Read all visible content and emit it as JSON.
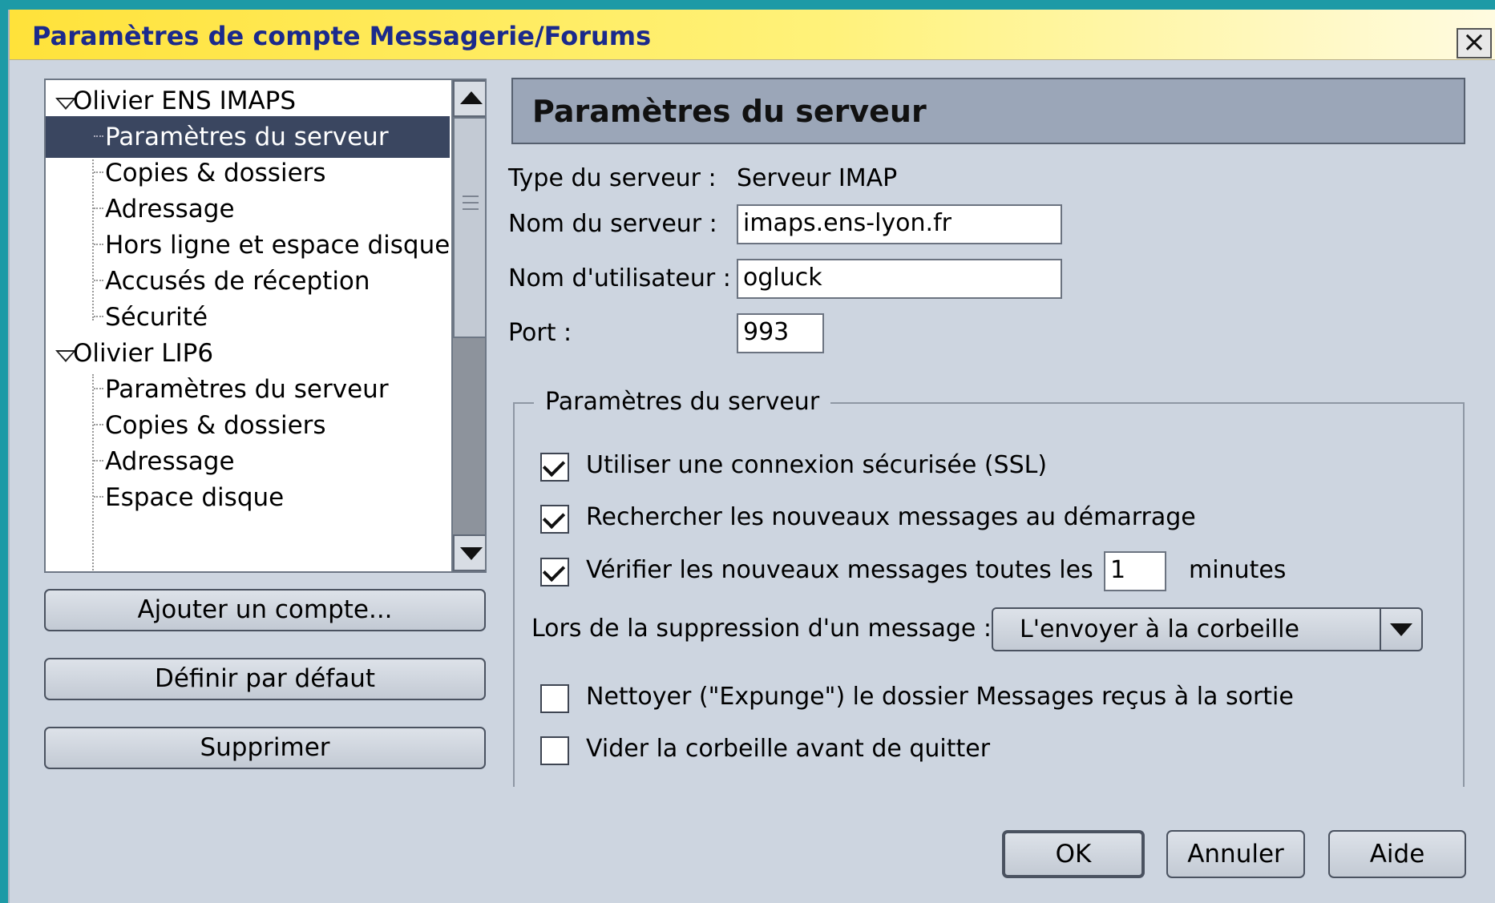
{
  "window": {
    "title": "Paramètres de compte Messagerie/Forums",
    "close_label": "×"
  },
  "tree": {
    "accounts": [
      {
        "name": "Olivier ENS IMAPS",
        "items": [
          "Paramètres du serveur",
          "Copies & dossiers",
          "Adressage",
          "Hors ligne et espace disque",
          "Accusés de réception",
          "Sécurité"
        ]
      },
      {
        "name": "Olivier LIP6",
        "items": [
          "Paramètres du serveur",
          "Copies & dossiers",
          "Adressage",
          "Espace disque"
        ]
      }
    ],
    "selected": "Paramètres du serveur"
  },
  "sidebar_buttons": {
    "add_account": "Ajouter un compte...",
    "set_default": "Définir par défaut",
    "delete": "Supprimer"
  },
  "panel": {
    "header": "Paramètres du serveur",
    "server_type_label": "Type du serveur :",
    "server_type_value": "Serveur IMAP",
    "server_name_label": "Nom du serveur :",
    "server_name_value": "imaps.ens-lyon.fr",
    "username_label": "Nom d'utilisateur :",
    "username_value": "ogluck",
    "port_label": "Port  :",
    "port_value": "993"
  },
  "server_settings": {
    "legend": "Paramètres du serveur",
    "use_ssl": {
      "label": "Utiliser une connexion sécurisée (SSL)",
      "checked": true
    },
    "check_on_startup": {
      "label": "Rechercher les nouveaux messages au démarrage",
      "checked": true
    },
    "check_every": {
      "label": "Vérifier les nouveaux messages toutes les",
      "checked": true,
      "value": "1",
      "unit": "minutes"
    },
    "on_delete_label": "Lors de la suppression d'un message :",
    "on_delete_value": "L'envoyer à la corbeille",
    "expunge": {
      "label": "Nettoyer (\"Expunge\") le dossier Messages reçus à la sortie",
      "checked": false
    },
    "empty_trash": {
      "label": "Vider la corbeille avant de quitter",
      "checked": false
    }
  },
  "dialog_buttons": {
    "ok": "OK",
    "cancel": "Annuler",
    "help": "Aide"
  },
  "colors": {
    "titlebar": "#ffe23a",
    "title_text": "#1b2a8c",
    "selection": "#3a4660",
    "background": "#cdd5e0"
  }
}
